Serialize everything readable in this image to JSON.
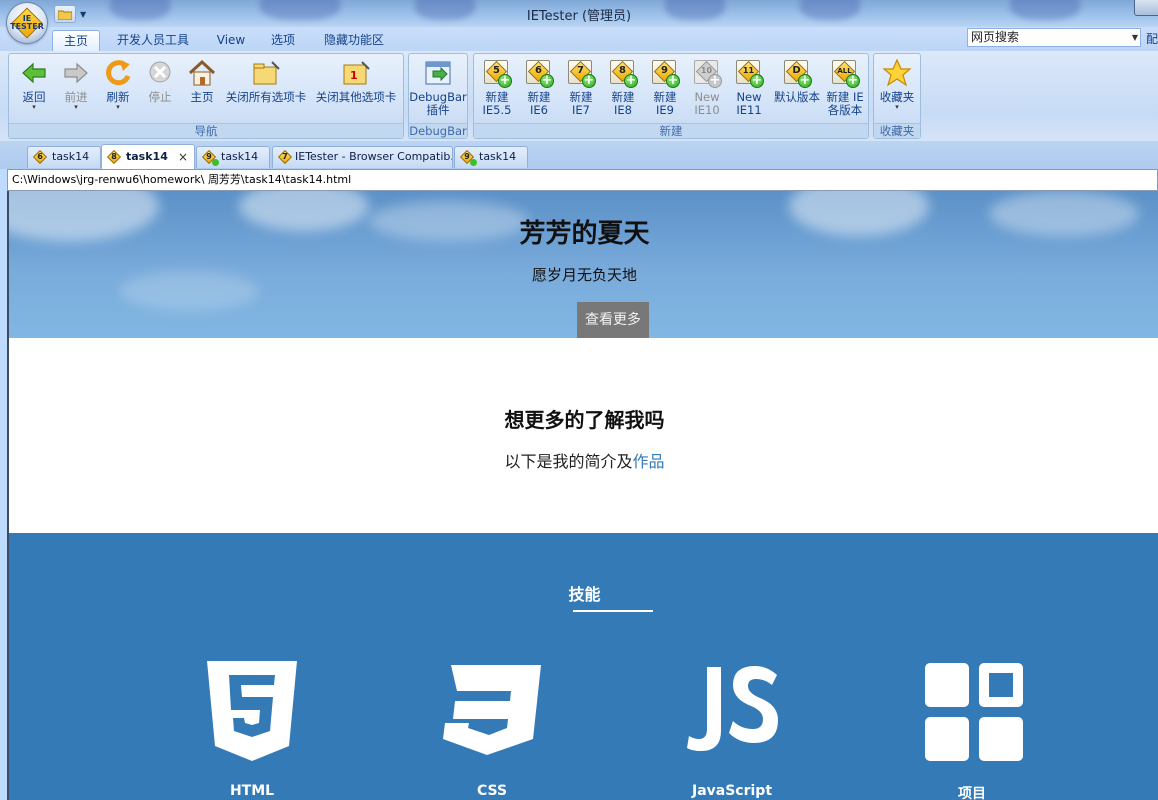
{
  "window": {
    "title": "IETester (管理员)"
  },
  "orb": {
    "text": "IE TESTER"
  },
  "ribbon_tabs": [
    "主页",
    "开发人员工具",
    "View",
    "选项",
    "隐藏功能区"
  ],
  "search": {
    "value": "网页搜索",
    "config_label": "配"
  },
  "groups": {
    "nav": {
      "label": "导航",
      "back": "返回",
      "forward": "前进",
      "refresh": "刷新",
      "stop": "停止",
      "home": "主页",
      "close_all": "关闭所有选项卡",
      "close_others": "关闭其他选项卡",
      "close_others_badge": "1"
    },
    "debugbar": {
      "label": "DebugBar",
      "btn_line1": "DebugBar",
      "btn_line2": "插件"
    },
    "new": {
      "label": "新建",
      "items": [
        {
          "badge": "5",
          "line1": "新建",
          "line2": "IE5.5"
        },
        {
          "badge": "6",
          "line1": "新建",
          "line2": "IE6"
        },
        {
          "badge": "7",
          "line1": "新建",
          "line2": "IE7"
        },
        {
          "badge": "8",
          "line1": "新建",
          "line2": "IE8"
        },
        {
          "badge": "9",
          "line1": "新建",
          "line2": "IE9"
        },
        {
          "badge": "10",
          "line1": "New",
          "line2": "IE10"
        },
        {
          "badge": "11",
          "line1": "New",
          "line2": "IE11"
        },
        {
          "badge": "D",
          "line1": "默认版本",
          "line2": ""
        },
        {
          "badge": "ALL",
          "line1": "新建 IE",
          "line2": "各版本"
        }
      ]
    },
    "favorites": {
      "label": "收藏夹",
      "btn": "收藏夹"
    }
  },
  "doc_tabs": [
    {
      "badge": "6",
      "label": "task14"
    },
    {
      "badge": "8",
      "label": "task14",
      "close": "×"
    },
    {
      "badge": "9",
      "label": "task14"
    },
    {
      "badge": "7",
      "label": "IETester - Browser Compatib..."
    },
    {
      "badge": "9",
      "label": "task14"
    }
  ],
  "address": "C:\\Windows\\jrg-renwu6\\homework\\ 周芳芳\\task14\\task14.html",
  "page": {
    "hero": {
      "title": "芳芳的夏天",
      "subtitle": "愿岁月无负天地",
      "button": "查看更多"
    },
    "about": {
      "heading": "想更多的了解我吗",
      "text": "以下是我的简介及",
      "link": "作品"
    },
    "skills": {
      "heading": "技能",
      "items": [
        {
          "icon": "html5-icon",
          "label": "HTML"
        },
        {
          "icon": "css3-icon",
          "label": "CSS"
        },
        {
          "icon": "js-icon",
          "label": "JavaScript"
        },
        {
          "icon": "grid-icon",
          "label": "项目"
        }
      ]
    }
  },
  "colors": {
    "accent": "#337ab7",
    "hero_sky": "#79abdb",
    "button_gray": "#787878"
  }
}
